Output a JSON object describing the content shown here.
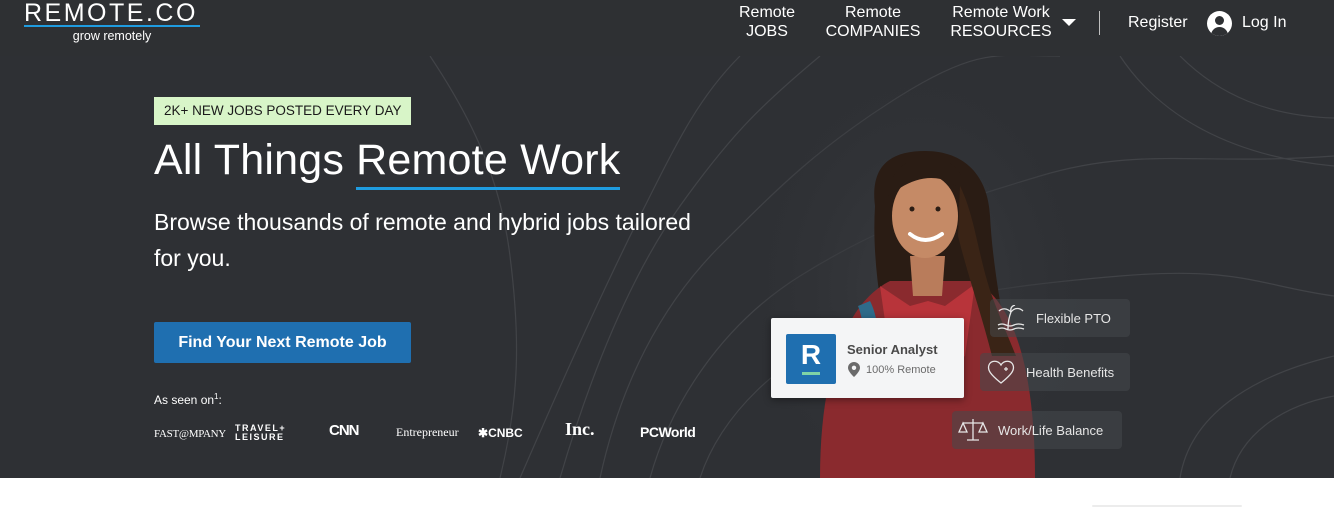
{
  "header": {
    "logo_word": "REMOTE.CO",
    "logo_tagline": "grow remotely",
    "nav": {
      "jobs_line1": "Remote",
      "jobs_line2": "JOBS",
      "companies_line1": "Remote",
      "companies_line2": "COMPANIES",
      "resources_line1": "Remote Work",
      "resources_line2": "RESOURCES"
    },
    "register_label": "Register",
    "login_label": "Log In"
  },
  "hero": {
    "badge": "2K+ NEW JOBS POSTED EVERY DAY",
    "headline_start": "All Things ",
    "headline_underlined": "Remote Work",
    "subhead": "Browse thousands of remote and hybrid jobs tailored for you.",
    "cta_label": "Find Your Next Remote Job",
    "seen_on_label": "As seen on",
    "seen_on_footnote": "1",
    "seen_on_suffix": ":",
    "press": {
      "fast_company": "FAST@MPANY",
      "travel_line1": "TRAVEL+",
      "travel_line2": "LEISURE",
      "cnn": "CNN",
      "entrepreneur": "Entrepreneur",
      "cnbc": "CNBC",
      "inc": "Inc.",
      "pcworld": "PCWorld"
    },
    "job_card": {
      "logo_letter": "R",
      "title": "Senior Analyst",
      "location": "100% Remote"
    },
    "benefits": {
      "pto": "Flexible PTO",
      "health": "Health Benefits",
      "work_life": "Work/Life Balance"
    }
  },
  "colors": {
    "header_bg": "#2e3033",
    "hero_bg": "#2e3034",
    "accent_blue": "#1f9ce0",
    "cta_blue": "#1f6fb0",
    "badge_green": "#d8f5c8"
  },
  "icons": {
    "caret": "chevron-down-icon",
    "user": "user-circle-icon",
    "pin": "map-pin-icon",
    "pto": "palm-tree-icon",
    "health": "heart-plus-icon",
    "work_life": "scales-icon"
  }
}
